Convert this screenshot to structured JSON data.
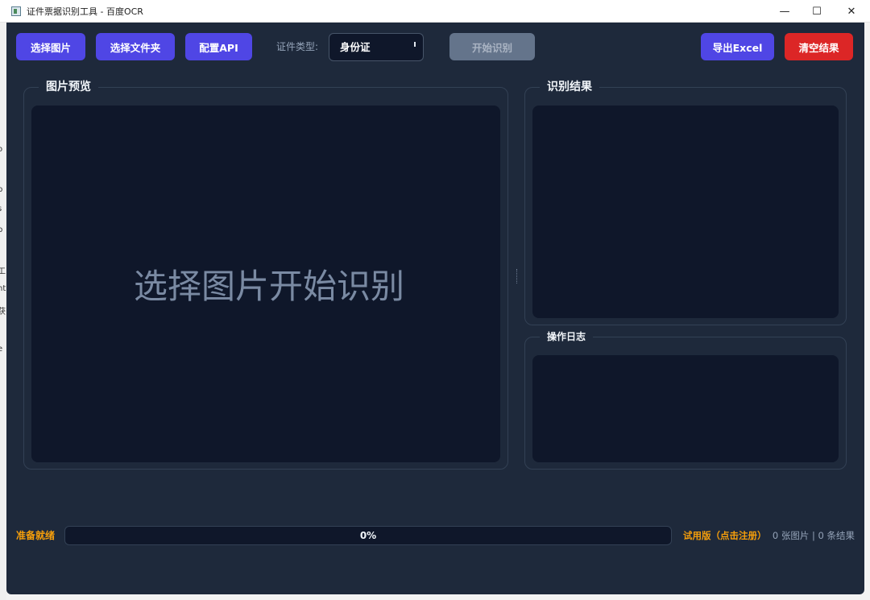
{
  "window": {
    "title": "证件票据识别工具 - 百度OCR",
    "controls": {
      "minimize": "—",
      "maximize": "☐",
      "close": "✕"
    }
  },
  "toolbar": {
    "select_image": "选择图片",
    "select_folder": "选择文件夹",
    "config_api": "配置API",
    "doc_type_label": "证件类型:",
    "doc_type_value": "身份证",
    "start_recognition": "开始识别",
    "export_excel": "导出Excel",
    "clear_results": "清空结果"
  },
  "preview": {
    "title": "图片预览",
    "placeholder": "选择图片开始识别"
  },
  "results": {
    "title": "识别结果"
  },
  "log": {
    "title": "操作日志"
  },
  "statusbar": {
    "status": "准备就绪",
    "progress_value": 0,
    "progress_text": "0%",
    "trial": "试用版（点击注册）",
    "counts": "0 张图片 | 0 条结果"
  },
  "colors": {
    "background": "#1e293b",
    "panel": "#0f172a",
    "accent": "#4f46e5",
    "danger": "#dc2626",
    "warning": "#f59e0b",
    "disabled": "#64748b"
  },
  "desktop_fragments": [
    "o",
    "p",
    "s",
    "p",
    "工",
    "nt",
    "获",
    "e"
  ]
}
